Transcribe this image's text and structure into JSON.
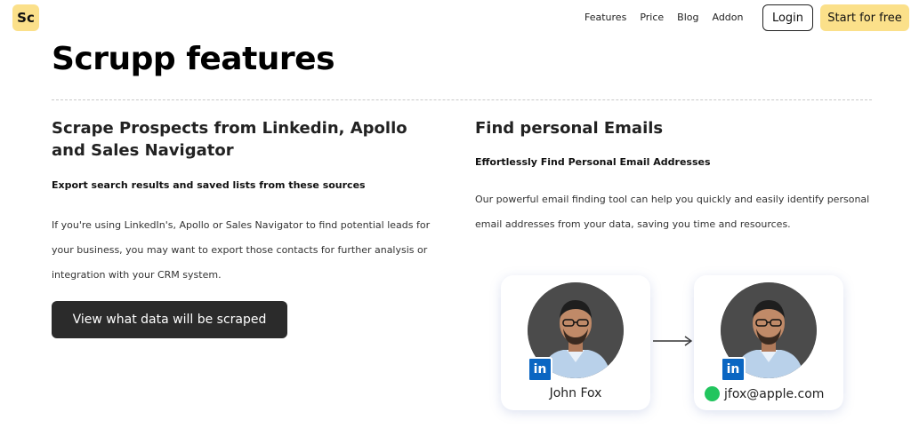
{
  "nav": {
    "logo": "Sc",
    "links": [
      "Features",
      "Price",
      "Blog",
      "Addon"
    ],
    "login": "Login",
    "start": "Start for free"
  },
  "title": "Scrupp features",
  "left": {
    "heading": "Scrape Prospects from Linkedin, Apollo and Sales Navigator",
    "subheading": "Export search results and saved lists from these sources",
    "body": "If you're using LinkedIn's, Apollo or Sales Navigator to find potential leads for your business, you may want to export those contacts for further analysis or integration with your CRM system.",
    "button": "View what data will be scraped"
  },
  "right": {
    "heading": "Find personal Emails",
    "subheading": "Effortlessly Find Personal Email Addresses",
    "body": "Our powerful email finding tool can help you quickly and easily identify personal email addresses from your data, saving you time and resources."
  },
  "cards": {
    "profile_name": "John Fox",
    "badge": "in",
    "email": "jfox@apple.com"
  },
  "colors": {
    "accent": "#fbe08a",
    "button_dark": "#2b2b2b",
    "linkedin": "#0a66c2",
    "status_green": "#22c55e"
  }
}
